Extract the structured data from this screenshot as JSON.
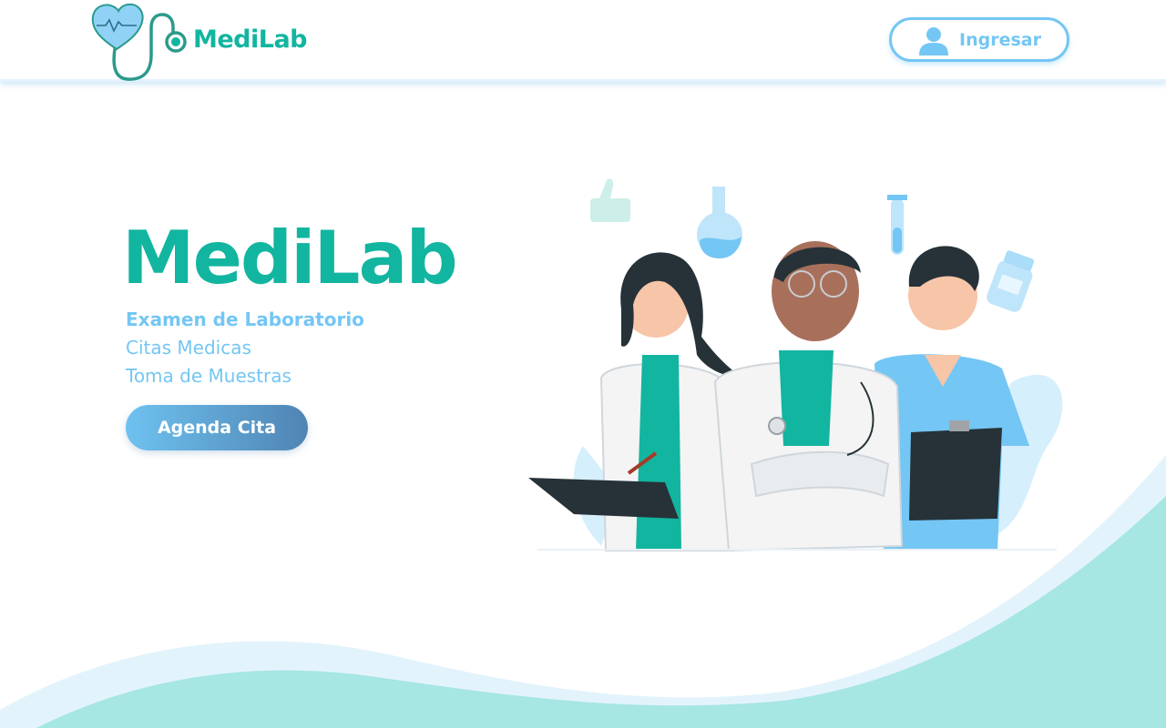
{
  "header": {
    "brand": "MediLab",
    "login_label": "Ingresar"
  },
  "hero": {
    "title": "MediLab",
    "services": [
      "Examen de Laboratorio",
      "Citas Medicas",
      "Toma de Muestras"
    ],
    "cta_label": "Agenda Cita"
  },
  "colors": {
    "brand_teal": "#12b5a0",
    "accent_blue": "#74c6f4",
    "wave_teal": "#a6e6e3",
    "wave_light": "#e3f3fc"
  },
  "icons": {
    "logo": "heart-stethoscope-icon",
    "login": "user-icon"
  }
}
